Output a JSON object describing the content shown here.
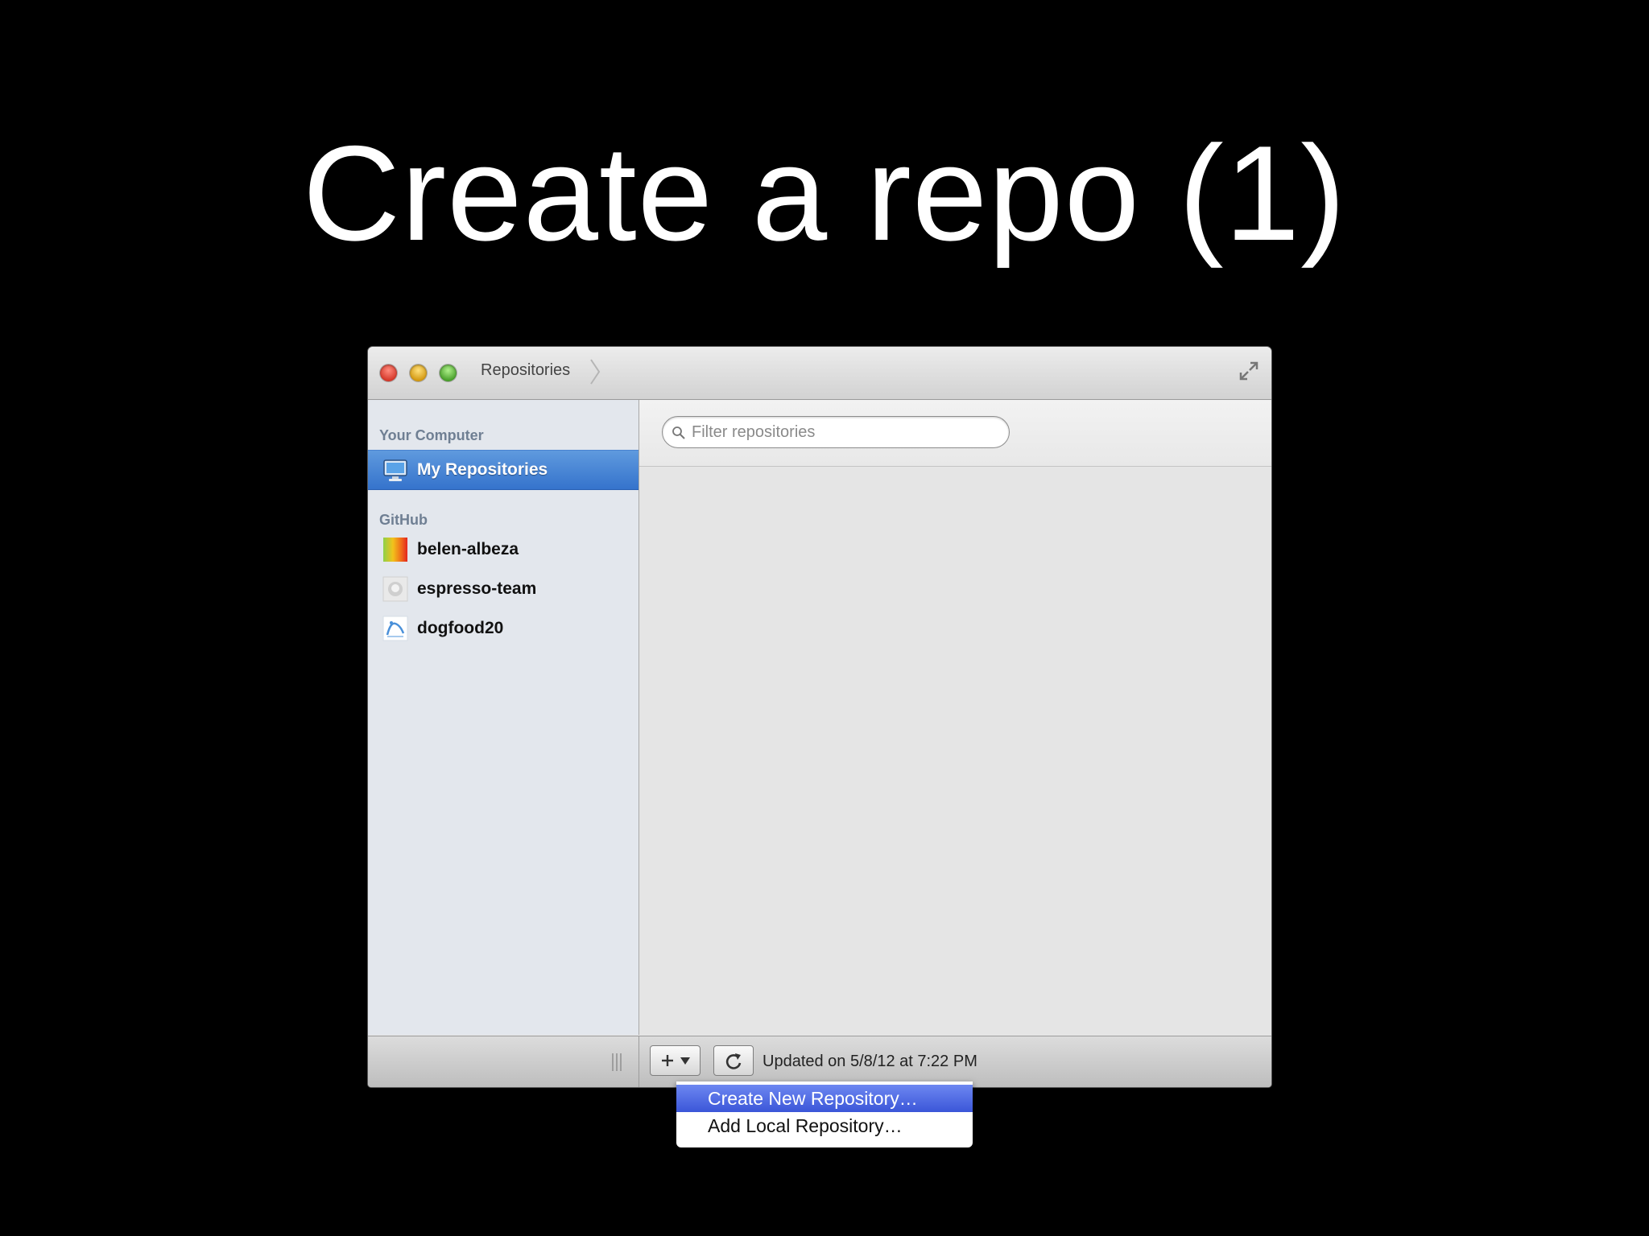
{
  "slide": {
    "title": "Create a repo (1)"
  },
  "window": {
    "breadcrumb": "Repositories"
  },
  "sidebar": {
    "groups": [
      {
        "title": "Your Computer",
        "items": [
          {
            "label": "My Repositories",
            "icon": "monitor-icon",
            "selected": true
          }
        ]
      },
      {
        "title": "GitHub",
        "items": [
          {
            "label": "belen-albeza",
            "icon": "avatar-gradient-icon"
          },
          {
            "label": "espresso-team",
            "icon": "octocat-avatar-icon"
          },
          {
            "label": "dogfood20",
            "icon": "lab-avatar-icon"
          }
        ]
      }
    ]
  },
  "main": {
    "filter_placeholder": "Filter repositories"
  },
  "bottom": {
    "status": "Updated on 5/8/12 at 7:22 PM"
  },
  "menu": {
    "items": [
      {
        "label": "Create New Repository…",
        "highlighted": true
      },
      {
        "label": "Add Local Repository…",
        "highlighted": false
      }
    ]
  },
  "colors": {
    "selection": "#3573cc",
    "menu_highlight": "#3b56d8",
    "background": "#000000"
  }
}
